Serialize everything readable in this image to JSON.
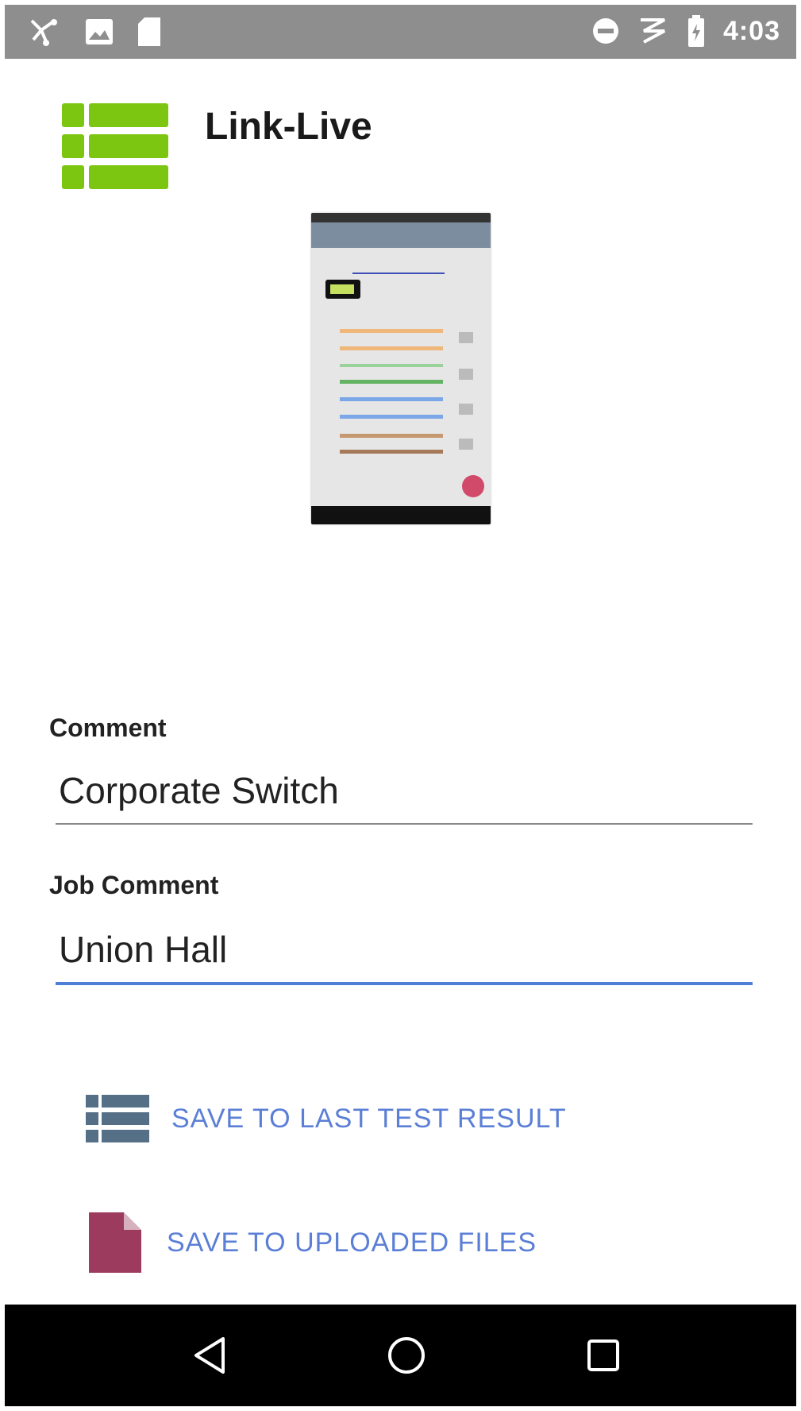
{
  "status_bar": {
    "time": "4:03",
    "left_icons": [
      "usb-debug-icon",
      "image-icon",
      "sd-card-icon"
    ],
    "right_icons": [
      "do-not-disturb-icon",
      "no-signal-icon",
      "battery-charging-icon"
    ]
  },
  "header": {
    "app_title": "Link-Live",
    "logo_color": "#7cc511"
  },
  "form": {
    "comment_label": "Comment",
    "comment_value": "Corporate Switch",
    "job_comment_label": "Job Comment",
    "job_comment_value": "Union Hall",
    "focus_color": "#4f7fd6"
  },
  "actions": {
    "save_last_test": "SAVE TO LAST TEST RESULT",
    "save_uploaded": "SAVE TO UPLOADED FILES",
    "label_color": "#5b7fd6",
    "list_icon_color": "#556f86",
    "file_icon_color": "#9c3b5e"
  },
  "nav": {
    "buttons": [
      "back-icon",
      "home-icon",
      "recents-icon"
    ]
  }
}
